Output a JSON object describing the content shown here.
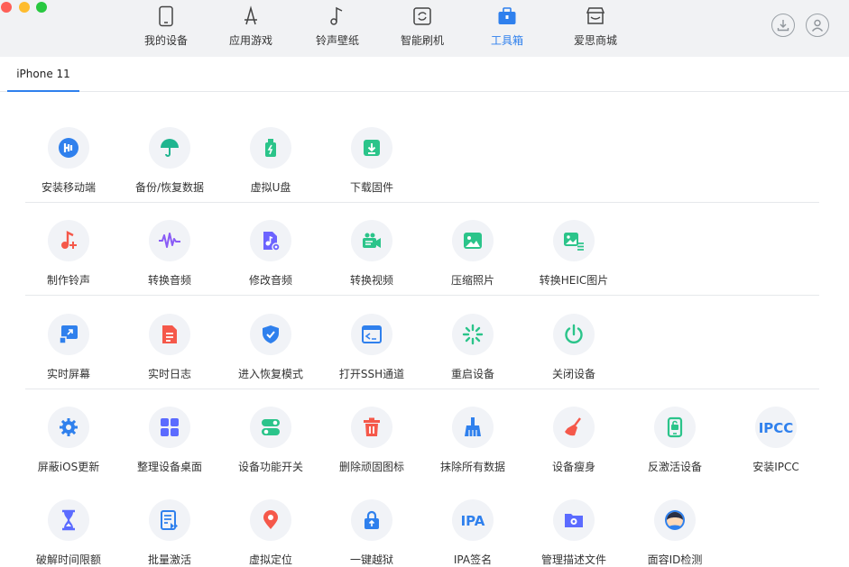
{
  "nav": {
    "items": [
      {
        "label": "我的设备",
        "icon": "phone-icon"
      },
      {
        "label": "应用游戏",
        "icon": "app-store-icon"
      },
      {
        "label": "铃声壁纸",
        "icon": "music-note-icon"
      },
      {
        "label": "智能刷机",
        "icon": "flash-icon"
      },
      {
        "label": "工具箱",
        "icon": "toolbox-icon"
      },
      {
        "label": "爱思商城",
        "icon": "store-icon"
      }
    ],
    "active_index": 4,
    "active_color": "#2f80ed"
  },
  "header_right": {
    "download_icon": "download-icon",
    "account_icon": "user-icon"
  },
  "device_tab": {
    "label": "iPhone 11"
  },
  "tools": {
    "row1": [
      {
        "label": "安装移动端",
        "icon": "install-mobile-icon",
        "color": "#2f80ed"
      },
      {
        "label": "备份/恢复数据",
        "icon": "umbrella-icon",
        "color": "#1fb58f"
      },
      {
        "label": "虚拟U盘",
        "icon": "usb-drive-icon",
        "color": "#2bc48a"
      },
      {
        "label": "下载固件",
        "icon": "firmware-download-icon",
        "color": "#2bc48a"
      }
    ],
    "row2": [
      {
        "label": "制作铃声",
        "icon": "ringtone-icon",
        "color": "#f5584a"
      },
      {
        "label": "转换音频",
        "icon": "waveform-icon",
        "color": "#8a5cf6"
      },
      {
        "label": "修改音频",
        "icon": "edit-audio-icon",
        "color": "#6c63ff"
      },
      {
        "label": "转换视频",
        "icon": "video-camera-icon",
        "color": "#2bc48a"
      },
      {
        "label": "压缩照片",
        "icon": "photo-icon",
        "color": "#2bc48a"
      },
      {
        "label": "转换HEIC图片",
        "icon": "heic-image-icon",
        "color": "#2bc48a"
      }
    ],
    "row3": [
      {
        "label": "实时屏幕",
        "icon": "screen-cast-icon",
        "color": "#2f80ed"
      },
      {
        "label": "实时日志",
        "icon": "log-file-icon",
        "color": "#f5584a"
      },
      {
        "label": "进入恢复模式",
        "icon": "shield-check-icon",
        "color": "#2f80ed"
      },
      {
        "label": "打开SSH通道",
        "icon": "terminal-icon",
        "color": "#2f80ed"
      },
      {
        "label": "重启设备",
        "icon": "restart-spinner-icon",
        "color": "#2bc48a"
      },
      {
        "label": "关闭设备",
        "icon": "power-icon",
        "color": "#2bc48a"
      }
    ],
    "row4": [
      {
        "label": "屏蔽iOS更新",
        "icon": "gear-icon",
        "color": "#2f80ed"
      },
      {
        "label": "整理设备桌面",
        "icon": "grid-icon",
        "color": "#5b6bff"
      },
      {
        "label": "设备功能开关",
        "icon": "toggle-icon",
        "color": "#2bc48a"
      },
      {
        "label": "删除顽固图标",
        "icon": "trash-icon",
        "color": "#f5584a"
      },
      {
        "label": "抹除所有数据",
        "icon": "brush-icon",
        "color": "#2f80ed"
      },
      {
        "label": "设备瘦身",
        "icon": "broom-icon",
        "color": "#f5584a"
      },
      {
        "label": "反激活设备",
        "icon": "phone-unlock-icon",
        "color": "#2bc48a"
      },
      {
        "label": "安装IPCC",
        "icon": "ipcc-icon",
        "color": "#2f80ed",
        "glyph": "IPCC"
      }
    ],
    "row5": [
      {
        "label": "破解时间限额",
        "icon": "hourglass-icon",
        "color": "#5b6bff"
      },
      {
        "label": "批量激活",
        "icon": "batch-activate-icon",
        "color": "#2f80ed"
      },
      {
        "label": "虚拟定位",
        "icon": "location-pin-icon",
        "color": "#f5584a"
      },
      {
        "label": "一键越狱",
        "icon": "lock-up-icon",
        "color": "#2f80ed"
      },
      {
        "label": "IPA签名",
        "icon": "ipa-icon",
        "color": "#2f80ed",
        "glyph": "IPA"
      },
      {
        "label": "管理描述文件",
        "icon": "profile-folder-icon",
        "color": "#5b6bff"
      },
      {
        "label": "面容ID检测",
        "icon": "face-id-icon",
        "color": "#2f80ed"
      }
    ]
  }
}
